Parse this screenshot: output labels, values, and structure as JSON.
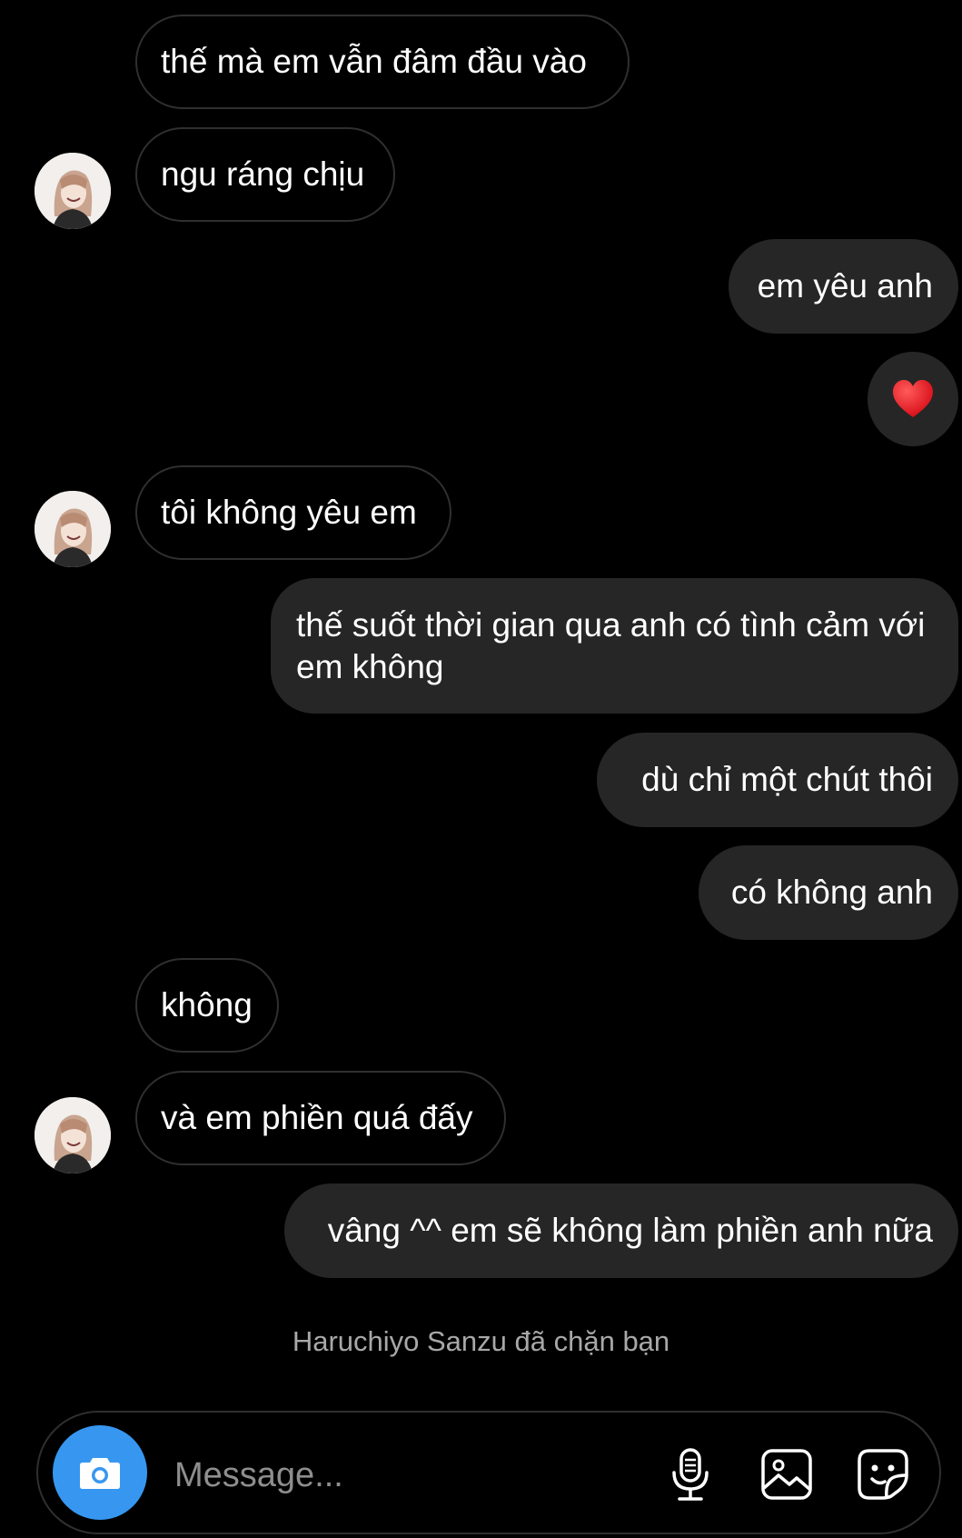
{
  "contact": {
    "name": "Haruchiyo Sanzu"
  },
  "messages": [
    {
      "side": "in",
      "text": "thế mà em vẫn đâm đầu vào"
    },
    {
      "side": "in",
      "text": "ngu ráng chịu",
      "avatar": true
    },
    {
      "side": "out",
      "text": "em yêu anh"
    },
    {
      "side": "out",
      "type": "heart-emoji"
    },
    {
      "side": "in",
      "text": "tôi không yêu em",
      "avatar": true
    },
    {
      "side": "out",
      "text": "thế suốt thời gian qua anh có tình cảm với em không"
    },
    {
      "side": "out",
      "text": "dù chỉ một chút thôi"
    },
    {
      "side": "out",
      "text": "có không anh"
    },
    {
      "side": "in",
      "text": "không"
    },
    {
      "side": "in",
      "text": "và em phiền quá đấy",
      "avatar": true
    },
    {
      "side": "out",
      "text": "vâng ^^ em sẽ không làm phiền anh nữa"
    }
  ],
  "system_notice": "Haruchiyo Sanzu đã chặn bạn",
  "composer": {
    "placeholder": "Message...",
    "icons": [
      "camera-icon",
      "microphone-icon",
      "gallery-icon",
      "sticker-icon"
    ]
  },
  "colors": {
    "background": "#000000",
    "outgoing_bubble": "#262626",
    "incoming_border": "#2f2f2f",
    "camera_button": "#3797f0",
    "heart": "#ed1c24",
    "system_text": "#a8a8a8"
  }
}
